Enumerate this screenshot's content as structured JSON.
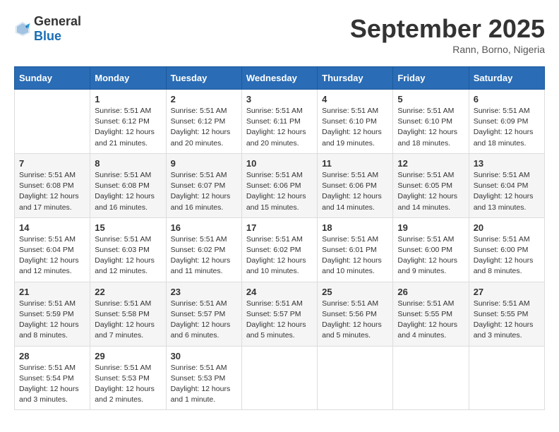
{
  "header": {
    "logo_general": "General",
    "logo_blue": "Blue",
    "month": "September 2025",
    "location": "Rann, Borno, Nigeria"
  },
  "days_of_week": [
    "Sunday",
    "Monday",
    "Tuesday",
    "Wednesday",
    "Thursday",
    "Friday",
    "Saturday"
  ],
  "weeks": [
    [
      {
        "day": "",
        "info": ""
      },
      {
        "day": "1",
        "info": "Sunrise: 5:51 AM\nSunset: 6:12 PM\nDaylight: 12 hours\nand 21 minutes."
      },
      {
        "day": "2",
        "info": "Sunrise: 5:51 AM\nSunset: 6:12 PM\nDaylight: 12 hours\nand 20 minutes."
      },
      {
        "day": "3",
        "info": "Sunrise: 5:51 AM\nSunset: 6:11 PM\nDaylight: 12 hours\nand 20 minutes."
      },
      {
        "day": "4",
        "info": "Sunrise: 5:51 AM\nSunset: 6:10 PM\nDaylight: 12 hours\nand 19 minutes."
      },
      {
        "day": "5",
        "info": "Sunrise: 5:51 AM\nSunset: 6:10 PM\nDaylight: 12 hours\nand 18 minutes."
      },
      {
        "day": "6",
        "info": "Sunrise: 5:51 AM\nSunset: 6:09 PM\nDaylight: 12 hours\nand 18 minutes."
      }
    ],
    [
      {
        "day": "7",
        "info": "Sunrise: 5:51 AM\nSunset: 6:08 PM\nDaylight: 12 hours\nand 17 minutes."
      },
      {
        "day": "8",
        "info": "Sunrise: 5:51 AM\nSunset: 6:08 PM\nDaylight: 12 hours\nand 16 minutes."
      },
      {
        "day": "9",
        "info": "Sunrise: 5:51 AM\nSunset: 6:07 PM\nDaylight: 12 hours\nand 16 minutes."
      },
      {
        "day": "10",
        "info": "Sunrise: 5:51 AM\nSunset: 6:06 PM\nDaylight: 12 hours\nand 15 minutes."
      },
      {
        "day": "11",
        "info": "Sunrise: 5:51 AM\nSunset: 6:06 PM\nDaylight: 12 hours\nand 14 minutes."
      },
      {
        "day": "12",
        "info": "Sunrise: 5:51 AM\nSunset: 6:05 PM\nDaylight: 12 hours\nand 14 minutes."
      },
      {
        "day": "13",
        "info": "Sunrise: 5:51 AM\nSunset: 6:04 PM\nDaylight: 12 hours\nand 13 minutes."
      }
    ],
    [
      {
        "day": "14",
        "info": "Sunrise: 5:51 AM\nSunset: 6:04 PM\nDaylight: 12 hours\nand 12 minutes."
      },
      {
        "day": "15",
        "info": "Sunrise: 5:51 AM\nSunset: 6:03 PM\nDaylight: 12 hours\nand 12 minutes."
      },
      {
        "day": "16",
        "info": "Sunrise: 5:51 AM\nSunset: 6:02 PM\nDaylight: 12 hours\nand 11 minutes."
      },
      {
        "day": "17",
        "info": "Sunrise: 5:51 AM\nSunset: 6:02 PM\nDaylight: 12 hours\nand 10 minutes."
      },
      {
        "day": "18",
        "info": "Sunrise: 5:51 AM\nSunset: 6:01 PM\nDaylight: 12 hours\nand 10 minutes."
      },
      {
        "day": "19",
        "info": "Sunrise: 5:51 AM\nSunset: 6:00 PM\nDaylight: 12 hours\nand 9 minutes."
      },
      {
        "day": "20",
        "info": "Sunrise: 5:51 AM\nSunset: 6:00 PM\nDaylight: 12 hours\nand 8 minutes."
      }
    ],
    [
      {
        "day": "21",
        "info": "Sunrise: 5:51 AM\nSunset: 5:59 PM\nDaylight: 12 hours\nand 8 minutes."
      },
      {
        "day": "22",
        "info": "Sunrise: 5:51 AM\nSunset: 5:58 PM\nDaylight: 12 hours\nand 7 minutes."
      },
      {
        "day": "23",
        "info": "Sunrise: 5:51 AM\nSunset: 5:57 PM\nDaylight: 12 hours\nand 6 minutes."
      },
      {
        "day": "24",
        "info": "Sunrise: 5:51 AM\nSunset: 5:57 PM\nDaylight: 12 hours\nand 5 minutes."
      },
      {
        "day": "25",
        "info": "Sunrise: 5:51 AM\nSunset: 5:56 PM\nDaylight: 12 hours\nand 5 minutes."
      },
      {
        "day": "26",
        "info": "Sunrise: 5:51 AM\nSunset: 5:55 PM\nDaylight: 12 hours\nand 4 minutes."
      },
      {
        "day": "27",
        "info": "Sunrise: 5:51 AM\nSunset: 5:55 PM\nDaylight: 12 hours\nand 3 minutes."
      }
    ],
    [
      {
        "day": "28",
        "info": "Sunrise: 5:51 AM\nSunset: 5:54 PM\nDaylight: 12 hours\nand 3 minutes."
      },
      {
        "day": "29",
        "info": "Sunrise: 5:51 AM\nSunset: 5:53 PM\nDaylight: 12 hours\nand 2 minutes."
      },
      {
        "day": "30",
        "info": "Sunrise: 5:51 AM\nSunset: 5:53 PM\nDaylight: 12 hours\nand 1 minute."
      },
      {
        "day": "",
        "info": ""
      },
      {
        "day": "",
        "info": ""
      },
      {
        "day": "",
        "info": ""
      },
      {
        "day": "",
        "info": ""
      }
    ]
  ]
}
